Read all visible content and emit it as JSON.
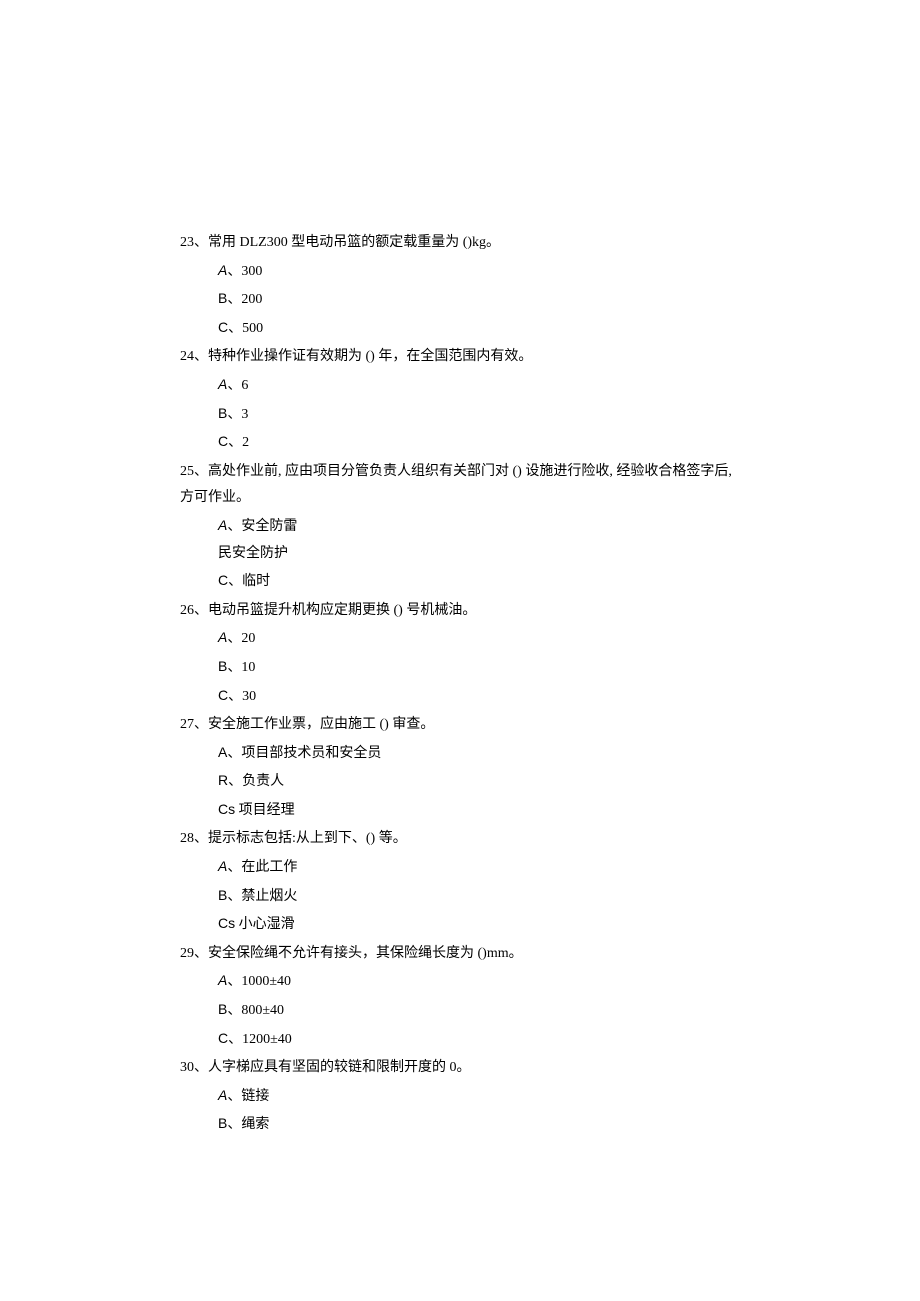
{
  "questions": [
    {
      "num": "23",
      "text": "常用 DLZ300 型电动吊篮的额定载重量为 ()kg。",
      "options": [
        {
          "label": "A",
          "sep": "、",
          "val": "300",
          "style": "italic"
        },
        {
          "label": "B",
          "sep": "、",
          "val": "200",
          "style": "plain"
        },
        {
          "label": "C",
          "sep": "、",
          "val": "500",
          "style": "plain"
        }
      ]
    },
    {
      "num": "24",
      "text": "特种作业操作证有效期为 () 年，在全国范围内有效。",
      "options": [
        {
          "label": "A",
          "sep": "、",
          "val": "6",
          "style": "italic"
        },
        {
          "label": "B",
          "sep": "、",
          "val": "3",
          "style": "plain"
        },
        {
          "label": "C",
          "sep": "、",
          "val": "2",
          "style": "plain"
        }
      ]
    },
    {
      "num": "25",
      "text": "高处作业前, 应由项目分管负责人组织有关部门对 () 设施进行险收, 经验收合格签字后,",
      "continuation": "方可作业。",
      "options": [
        {
          "label": "A",
          "sep": "、",
          "val": "安全防雷",
          "style": "italic"
        },
        {
          "label": "民",
          "sep": "",
          "val": "安全防护",
          "style": "plain-cn"
        },
        {
          "label": "C",
          "sep": "、",
          "val": "临时",
          "style": "plain"
        }
      ]
    },
    {
      "num": "26",
      "text": "电动吊篮提升机构应定期更换 () 号机械油。",
      "options": [
        {
          "label": "A",
          "sep": "、",
          "val": "20",
          "style": "italic"
        },
        {
          "label": "B",
          "sep": "、",
          "val": "10",
          "style": "plain"
        },
        {
          "label": "C",
          "sep": "、",
          "val": "30",
          "style": "plain"
        }
      ]
    },
    {
      "num": "27",
      "text": "安全施工作业票，应由施工 () 审查。",
      "options": [
        {
          "label": "A",
          "sep": "、",
          "val": "项目部技术员和安全员",
          "style": "plain"
        },
        {
          "label": "R",
          "sep": "、",
          "val": "负责人",
          "style": "plain"
        },
        {
          "label": "Cs",
          "sep": " ",
          "val": "项目经理",
          "style": "plain"
        }
      ]
    },
    {
      "num": "28",
      "text": "提示标志包括:从上到下、() 等。",
      "options": [
        {
          "label": "A",
          "sep": "、",
          "val": "在此工作",
          "style": "italic"
        },
        {
          "label": "B",
          "sep": "、",
          "val": "禁止烟火",
          "style": "plain"
        },
        {
          "label": "Cs",
          "sep": " ",
          "val": "小心湿滑",
          "style": "plain"
        }
      ]
    },
    {
      "num": "29",
      "text": "安全保险绳不允许有接头，其保险绳长度为 ()mm。",
      "options": [
        {
          "label": "A",
          "sep": "、",
          "val": "1000±40",
          "style": "italic"
        },
        {
          "label": "B",
          "sep": "、",
          "val": "800±40",
          "style": "plain"
        },
        {
          "label": "C",
          "sep": "、",
          "val": "1200±40",
          "style": "plain"
        }
      ]
    },
    {
      "num": "30",
      "text": "人字梯应具有坚固的较链和限制开度的 0。",
      "options": [
        {
          "label": "A",
          "sep": "、",
          "val": "链接",
          "style": "italic"
        },
        {
          "label": "B",
          "sep": "、",
          "val": "绳索",
          "style": "plain"
        }
      ]
    }
  ]
}
